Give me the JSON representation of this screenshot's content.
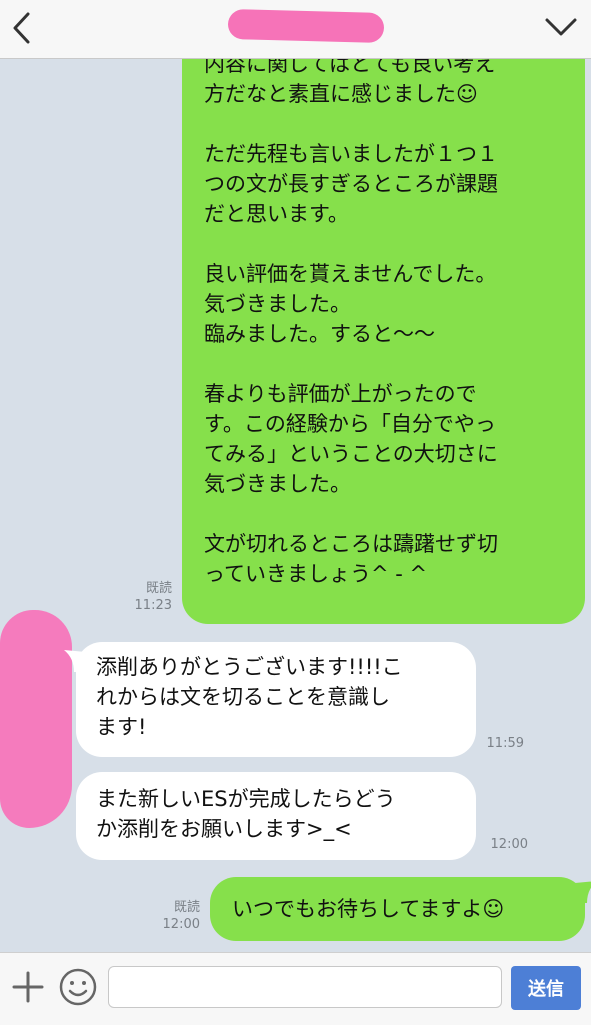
{
  "header": {
    "contact_name": ""
  },
  "messages": [
    {
      "id": "m1",
      "direction": "outgoing",
      "text": "内容に関してはとても良い考え\n方だなと素直に感じました☺\n\nただ先程も言いましたが１つ１\nつの文が長すぎるところが課題\nだと思います。\n\n良い評価を貰えませんでした。\n気づきました。\n臨みました。すると〜〜\n\n春よりも評価が上がったので\nす。この経験から「自分でやっ\nてみる」ということの大切さに\n気づきました。\n\n文が切れるところは躊躇せず切\nっていきましょう^ - ^",
      "read": "既読",
      "time": "11:23"
    },
    {
      "id": "m2",
      "direction": "incoming",
      "text": "添削ありがとうございます!!!!こ\nれからは文を切ることを意識し\nます!",
      "time": "11:59"
    },
    {
      "id": "m3",
      "direction": "incoming",
      "text": "また新しいESが完成したらどう\nか添削をお願いします>_<",
      "time": "12:00"
    },
    {
      "id": "m4",
      "direction": "outgoing",
      "text": "いつでもお待ちしてますよ☺",
      "read": "既読",
      "time": "12:00"
    }
  ],
  "input": {
    "placeholder": "",
    "value": "",
    "send_label": "送信"
  },
  "icons": {
    "back": "chevron-left-icon",
    "menu": "chevron-down-icon",
    "add": "plus-icon",
    "emoji": "emoji-icon"
  },
  "colors": {
    "outgoing_bubble": "#86e04b",
    "incoming_bubble": "#ffffff",
    "background": "#d7dfe8",
    "send_button": "#4d7fd6",
    "redaction": "#f673b8"
  }
}
